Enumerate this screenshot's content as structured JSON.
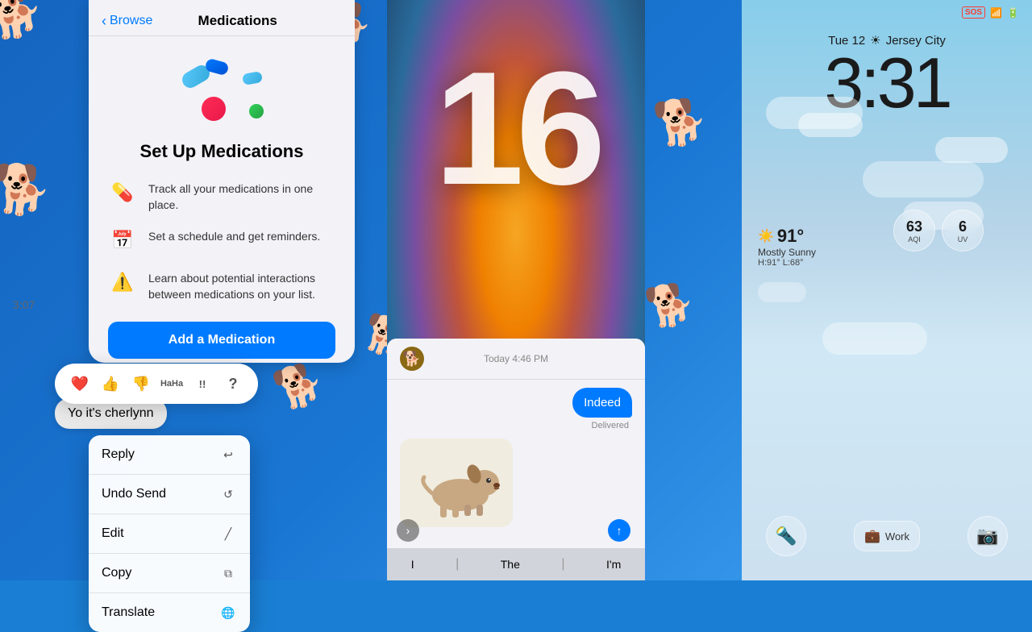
{
  "background": {
    "color": "#1976d2"
  },
  "medications_panel": {
    "back_label": "Browse",
    "title": "Medications",
    "heading": "Set Up Medications",
    "features": [
      {
        "icon": "💊",
        "text": "Track all your medications in one place."
      },
      {
        "icon": "📅",
        "text": "Set a schedule and get reminders."
      },
      {
        "icon": "⚠️",
        "text": "Learn about potential interactions between medications on your list."
      }
    ],
    "cta_button": "Add a Medication"
  },
  "messages_context": {
    "time": "3:07",
    "message_text": "Yo it's cherlynn",
    "reactions": [
      "❤️",
      "👍",
      "👎",
      "HaHa",
      "!!",
      "?"
    ],
    "menu_items": [
      {
        "label": "Reply",
        "icon": "↩"
      },
      {
        "label": "Undo Send",
        "icon": "↺"
      },
      {
        "label": "Edit",
        "icon": "/"
      },
      {
        "label": "Copy",
        "icon": "⧉"
      },
      {
        "label": "Translate",
        "icon": "🌐"
      }
    ]
  },
  "ios16_screen": {
    "number": "16",
    "timestamp": "Today 4:46 PM",
    "sent_message": "Indeed",
    "delivered_label": "Delivered",
    "keyboard_words": [
      "I",
      "The",
      "I'm"
    ]
  },
  "lockscreen": {
    "status_sos": "SOS",
    "date_label": "Tue 12",
    "weather_icon": "☀",
    "city": "Jersey City",
    "time": "3:31",
    "weather_temp": "91°",
    "weather_desc": "Mostly Sunny",
    "weather_hi_lo": "H:91° L:68°",
    "aqi_value": "63",
    "aqi_label": "AQI",
    "uv_value": "6",
    "uv_label": "UV",
    "controls": {
      "flashlight_icon": "🔦",
      "work_label": "Work",
      "camera_icon": "📷"
    }
  }
}
